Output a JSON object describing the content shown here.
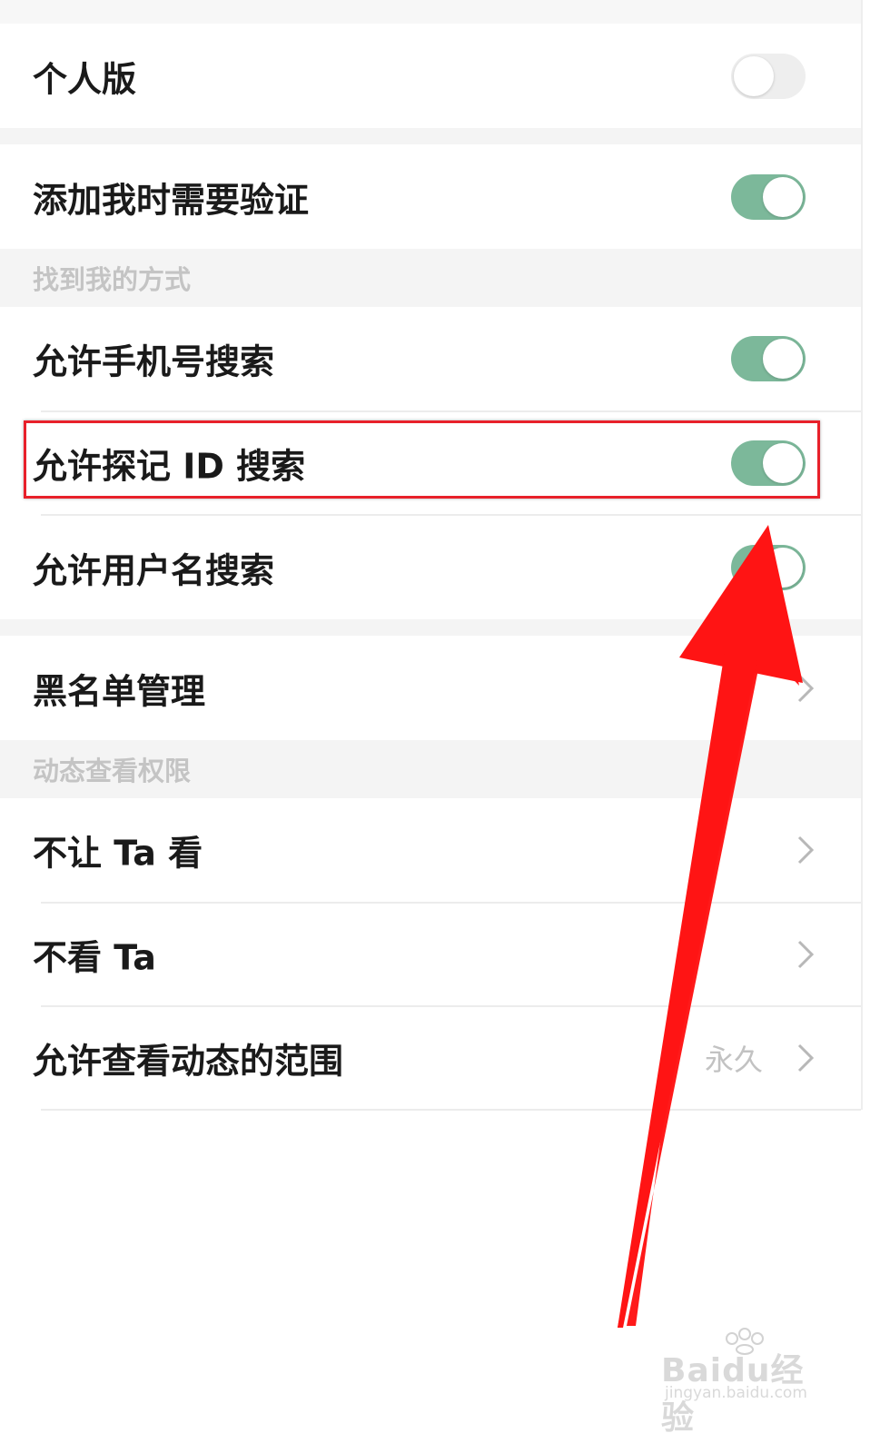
{
  "rows": {
    "personal_version": {
      "label": "个人版",
      "toggle": "off"
    },
    "verify_add": {
      "label": "添加我时需要验证",
      "toggle": "on"
    },
    "phone_search": {
      "label": "允许手机号搜索",
      "toggle": "on"
    },
    "id_search": {
      "label": "允许探记 ID 搜索",
      "toggle": "on"
    },
    "username_search": {
      "label": "允许用户名搜索",
      "toggle": "on"
    },
    "blacklist": {
      "label": "黑名单管理"
    },
    "hide_from": {
      "label": "不让 Ta 看"
    },
    "dont_see": {
      "label": "不看 Ta"
    },
    "moments_range": {
      "label": "允许查看动态的范围",
      "value": "永久"
    }
  },
  "sections": {
    "find_me": "找到我的方式",
    "moments_permission": "动态查看权限"
  },
  "colors": {
    "toggle_on": "#7cb89a",
    "toggle_off": "#eeeeee",
    "highlight": "#e8202a",
    "arrow": "#ff1a1a"
  },
  "icons": {
    "chevron": "chevron-right-icon",
    "annotation": "red-arrow-icon"
  },
  "watermark": {
    "brand": "Baidu经验",
    "url": "jingyan.baidu.com"
  }
}
